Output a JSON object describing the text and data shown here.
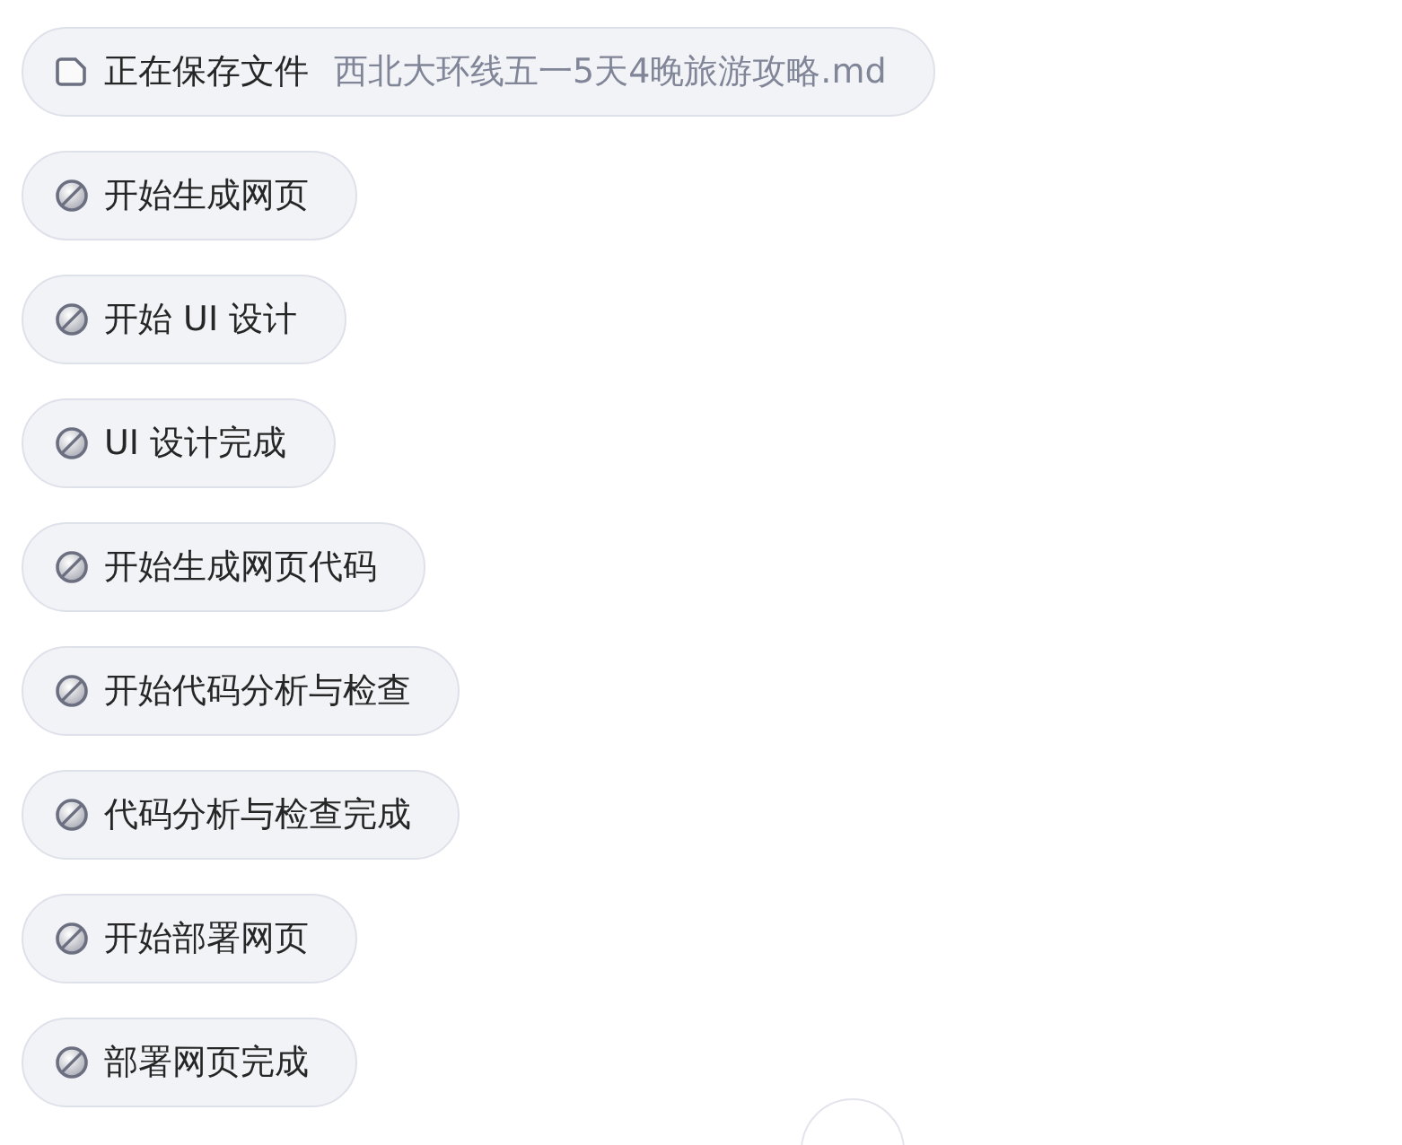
{
  "steps": [
    {
      "kind": "file",
      "label": "正在保存文件",
      "detail": "西北大环线五一5天4晚旅游攻略.md"
    },
    {
      "kind": "step",
      "label": "开始生成网页"
    },
    {
      "kind": "step",
      "label": "开始 UI 设计"
    },
    {
      "kind": "step",
      "label": "UI 设计完成"
    },
    {
      "kind": "step",
      "label": "开始生成网页代码"
    },
    {
      "kind": "step",
      "label": "开始代码分析与检查"
    },
    {
      "kind": "step",
      "label": "代码分析与检查完成"
    },
    {
      "kind": "step",
      "label": "开始部署网页"
    },
    {
      "kind": "step",
      "label": "部署网页完成"
    }
  ]
}
